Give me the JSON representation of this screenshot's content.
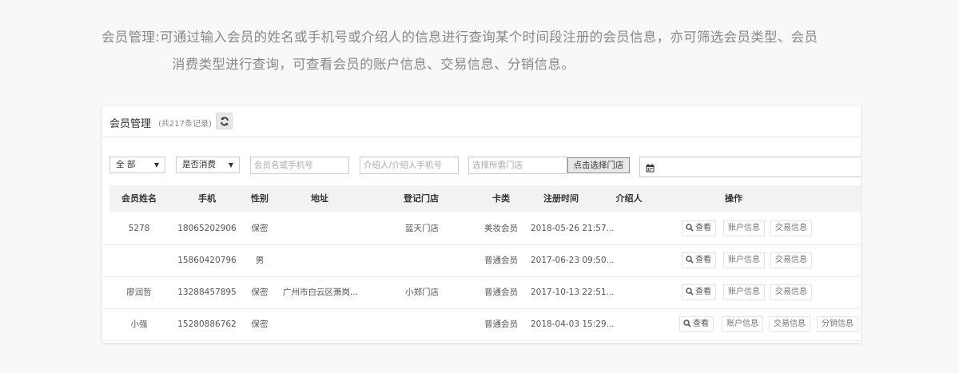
{
  "description": {
    "label": "会员管理:",
    "line1": "可通过输入会员的姓名或手机号或介绍人的信息进行查询某个时间段注册的会员信息，亦可筛选会员类型、会员",
    "line2": "消费类型进行查询，可查看会员的账户信息、交易信息、分销信息。"
  },
  "panel": {
    "title": "会员管理",
    "count": "(共217条记录)",
    "refresh_icon": "refresh-icon"
  },
  "filters": {
    "member_type": "全 部",
    "consume_type": "是否消费",
    "name_phone_placeholder": "会员名或手机号",
    "referrer_placeholder": "介绍人/介绍人手机号",
    "store_placeholder": "选择所需门店",
    "select_store_button": "点击选择门店",
    "date_icon": "calendar-icon"
  },
  "columns": [
    "会员姓名",
    "手机",
    "性别",
    "地址",
    "登记门店",
    "卡类",
    "注册时间",
    "介绍人",
    "操作"
  ],
  "rows": [
    {
      "name": "5278",
      "phone": "18065202906",
      "gender": "保密",
      "address": "",
      "store": "蓝天门店",
      "card": "美妆会员",
      "reg_time": "2018-05-26 21:57...",
      "referrer": "",
      "actions": [
        "查看",
        "账户信息",
        "交易信息"
      ]
    },
    {
      "name": "",
      "phone": "15860420796",
      "gender": "男",
      "address": "",
      "store": "",
      "card": "普通会员",
      "reg_time": "2017-06-23 09:50...",
      "referrer": "",
      "actions": [
        "查看",
        "账户信息",
        "交易信息"
      ]
    },
    {
      "name": "廖润哲",
      "phone": "13288457895",
      "gender": "保密",
      "address": "广州市白云区萧岗...",
      "store": "小郑门店",
      "card": "普通会员",
      "reg_time": "2017-10-13 22:51...",
      "referrer": "",
      "actions": [
        "查看",
        "账户信息",
        "交易信息"
      ]
    },
    {
      "name": "小强",
      "phone": "15280886762",
      "gender": "保密",
      "address": "",
      "store": "",
      "card": "普通会员",
      "reg_time": "2018-04-03 15:29...",
      "referrer": "",
      "actions": [
        "查看",
        "账户信息",
        "交易信息",
        "分销信息"
      ]
    }
  ]
}
